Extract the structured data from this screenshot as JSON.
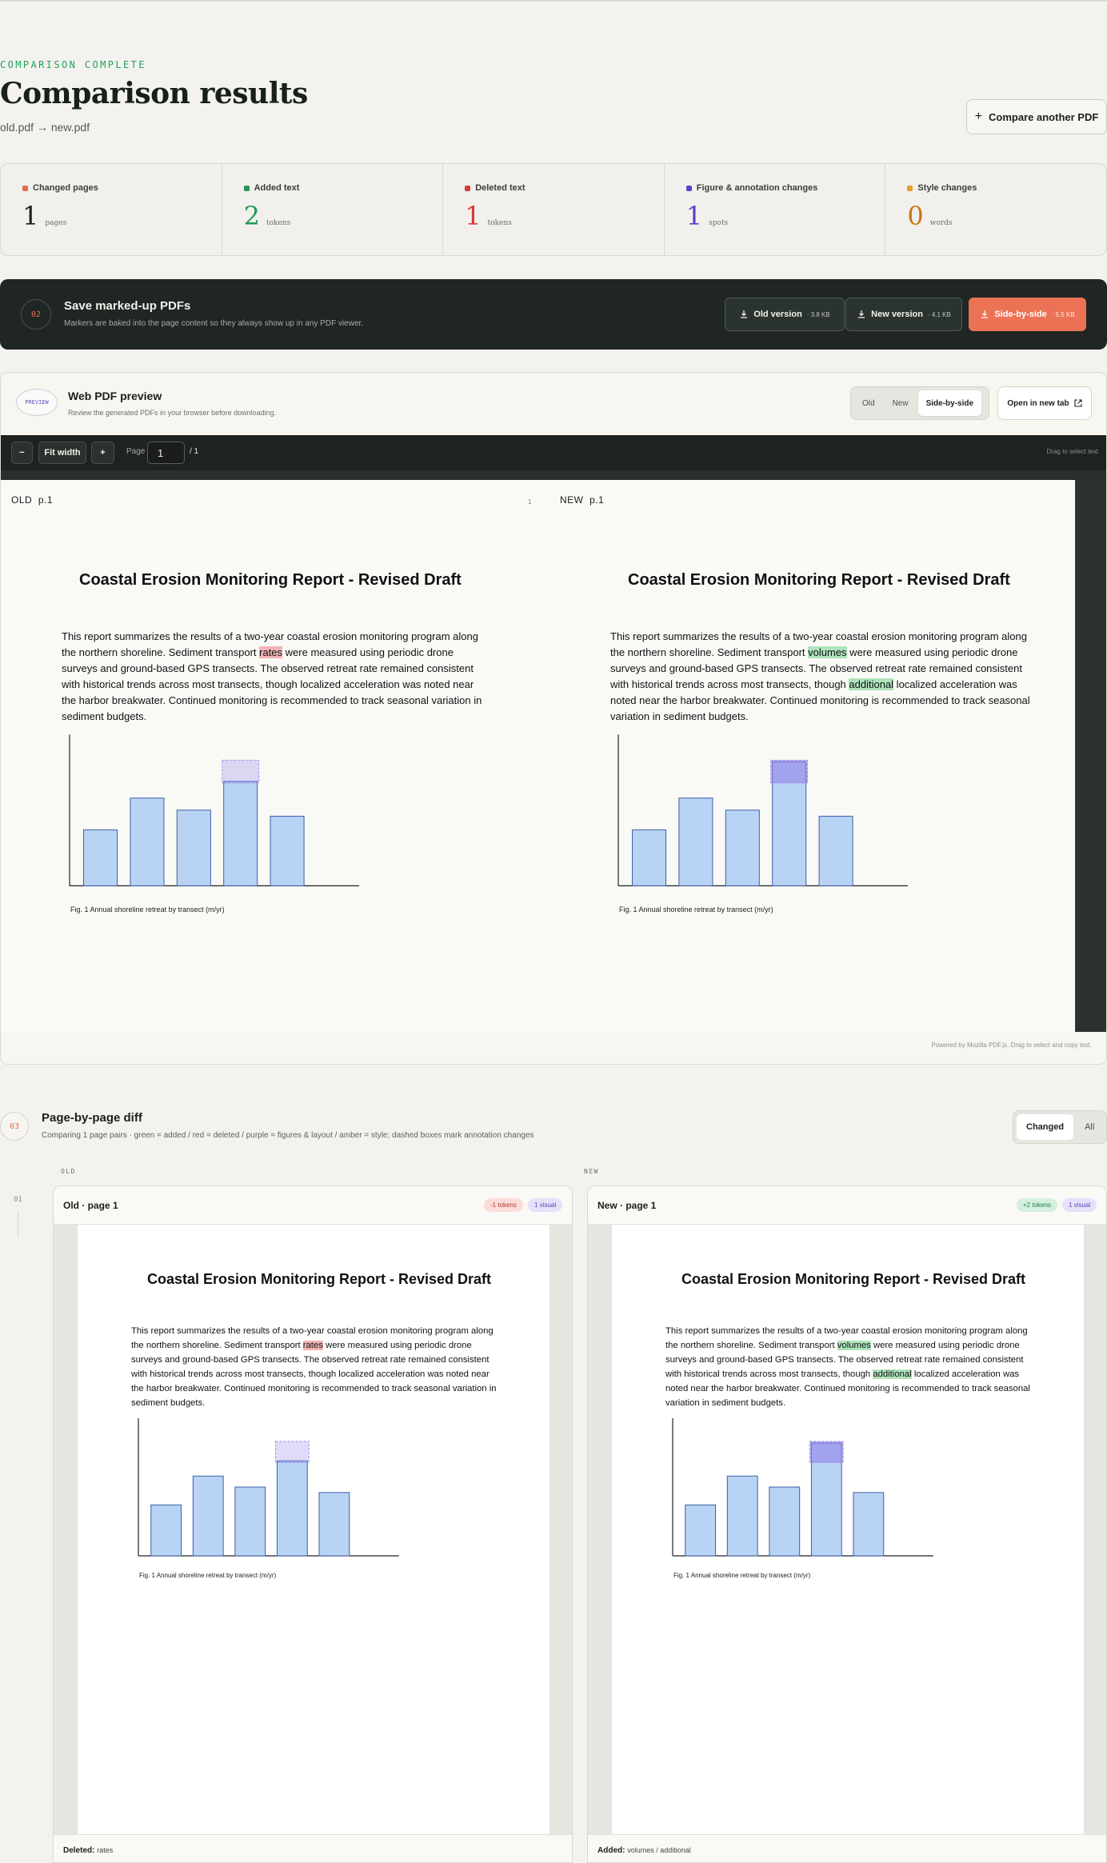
{
  "header": {
    "eyebrow": "COMPARISON COMPLETE",
    "title": "Comparison results",
    "old_file": "old.pdf",
    "arrow": "→",
    "new_file": "new.pdf",
    "compare_button": "Compare another PDF"
  },
  "stats": [
    {
      "label": "Changed pages",
      "value": "1",
      "unit": "pages",
      "color": "#e8694a"
    },
    {
      "label": "Added text",
      "value": "2",
      "unit": "tokens",
      "color": "#1f9a55"
    },
    {
      "label": "Deleted text",
      "value": "1",
      "unit": "tokens",
      "color": "#d63a3a"
    },
    {
      "label": "Figure & annotation changes",
      "value": "1",
      "unit": "spots",
      "color": "#5b3fc4"
    },
    {
      "label": "Style changes",
      "value": "0",
      "unit": "words",
      "color": "#c8780f"
    }
  ],
  "save": {
    "step": "02",
    "title": "Save marked-up PDFs",
    "subtitle": "Markers are baked into the page content so they always show up in any PDF viewer.",
    "buttons": [
      {
        "label": "Old version",
        "size": "· 3.8 KB"
      },
      {
        "label": "New version",
        "size": "· 4.1 KB"
      },
      {
        "label": "Side-by-side",
        "size": "· 5.5 KB"
      }
    ]
  },
  "preview": {
    "badge": "PREVIEW",
    "title": "Web PDF preview",
    "subtitle": "Review the generated PDFs in your browser before downloading.",
    "modes": [
      "Old",
      "New",
      "Side-by-side"
    ],
    "active_mode": "Side-by-side",
    "open_tab": "Open in new tab",
    "toolbar": {
      "zoom_out": "−",
      "fit": "Fit width",
      "zoom_in": "+",
      "page_label": "Page",
      "page_value": "1",
      "page_total": "/ 1",
      "drag_hint": "Drag to select text"
    },
    "old_label": "OLD  p.1",
    "new_label": "NEW  p.1",
    "center_number": "1",
    "footer": "Powered by Mozilla PDF.js. Drag to select and copy text."
  },
  "document": {
    "title": "Coastal Erosion Monitoring Report - Revised Draft",
    "old_lines": [
      [
        "This report summarizes the results of a two-year coastal erosion monitoring program along"
      ],
      [
        "the northern shoreline. Sediment transport ",
        {
          "del": "rates"
        },
        " were measured using periodic drone"
      ],
      [
        "surveys and ground-based GPS transects. The observed retreat rate remained consistent"
      ],
      [
        "with historical trends across most transects, though localized acceleration was noted near"
      ],
      [
        "the harbor breakwater. Continued monitoring is recommended to track seasonal variation in"
      ],
      [
        "sediment budgets."
      ]
    ],
    "new_lines": [
      [
        "This report summarizes the results of a two-year coastal erosion monitoring program along"
      ],
      [
        "the northern shoreline. Sediment transport ",
        {
          "add": "volumes"
        },
        " were measured using periodic drone"
      ],
      [
        "surveys and ground-based GPS transects. The observed retreat rate remained consistent"
      ],
      [
        "with historical trends across most transects, though ",
        {
          "add": "additional"
        },
        " localized acceleration was"
      ],
      [
        "noted near the harbor breakwater. Continued monitoring is recommended to track seasonal"
      ],
      [
        "variation in sediment budgets."
      ]
    ],
    "caption": "Fig. 1  Annual shoreline retreat by transect (m/yr)"
  },
  "chart_data": {
    "type": "bar",
    "title": "",
    "categories": [
      "",
      "",
      "",
      "",
      ""
    ],
    "old_values": [
      0.37,
      0.58,
      0.5,
      0.69,
      0.46
    ],
    "new_values": [
      0.37,
      0.58,
      0.5,
      0.82,
      0.46
    ],
    "changed_index": 3,
    "ylim": [
      0,
      1
    ],
    "fill_color": "#b8d3f3",
    "stroke_color": "#3d5fa8",
    "change_color": "#8f7ce8",
    "caption": "Fig. 1  Annual shoreline retreat by transect (m/yr)"
  },
  "pagediff": {
    "step": "03",
    "title": "Page-by-page diff",
    "subtitle": "Comparing 1 page pairs · green = added / red = deleted / purple = figures & layout / amber = style; dashed boxes mark annotation changes",
    "filters": [
      "Changed",
      "All"
    ],
    "active_filter": "Changed",
    "old_col": "OLD",
    "new_col": "NEW",
    "row_number": "01",
    "old_card": {
      "title": "Old · page 1",
      "chips": [
        "-1 tokens",
        "1 visual"
      ],
      "foot_label": "Deleted:",
      "foot_value": "rates"
    },
    "new_card": {
      "title": "New · page 1",
      "chips": [
        "+2 tokens",
        "1 visual"
      ],
      "foot_label": "Added:",
      "foot_value": "volumes / additional"
    }
  }
}
